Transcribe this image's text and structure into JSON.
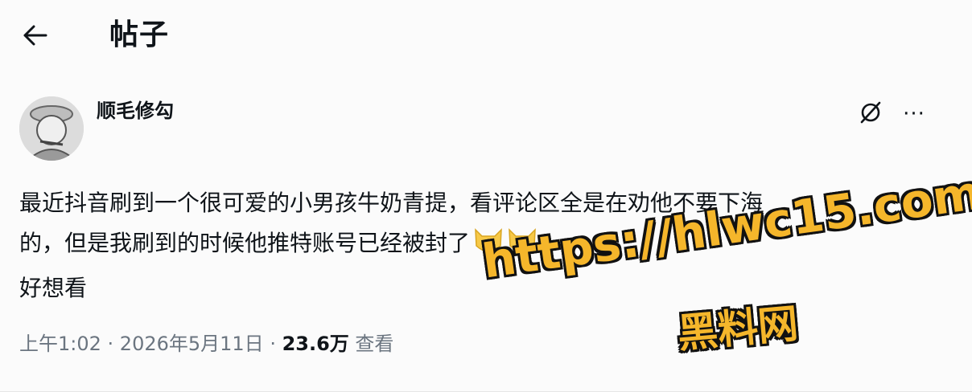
{
  "header": {
    "back_icon": "arrow-left-icon",
    "title": "帖子"
  },
  "post": {
    "author": {
      "name": "顺毛修勾",
      "avatar": "avatar-image"
    },
    "actions": {
      "grok_icon": "grok-icon",
      "more_label": "···"
    },
    "text_lines": [
      "最近抖音刷到一个很可爱的小男孩牛奶青提，看评论区全是在劝他不要下海",
      "的，但是我刷到的时候他推特账号已经被封了",
      "好想看"
    ],
    "emojis": [
      "cat-face-emoji",
      "cat-face-emoji"
    ],
    "meta": {
      "time": "上午1:02",
      "separator1": " · ",
      "date": "2026年5月11日",
      "separator2": " · ",
      "views": "23.6万",
      "views_label": " 查看"
    }
  },
  "watermark": {
    "url": "https://hlwc15.com",
    "site_name": "黑料网",
    "color": "#f5b62b"
  }
}
